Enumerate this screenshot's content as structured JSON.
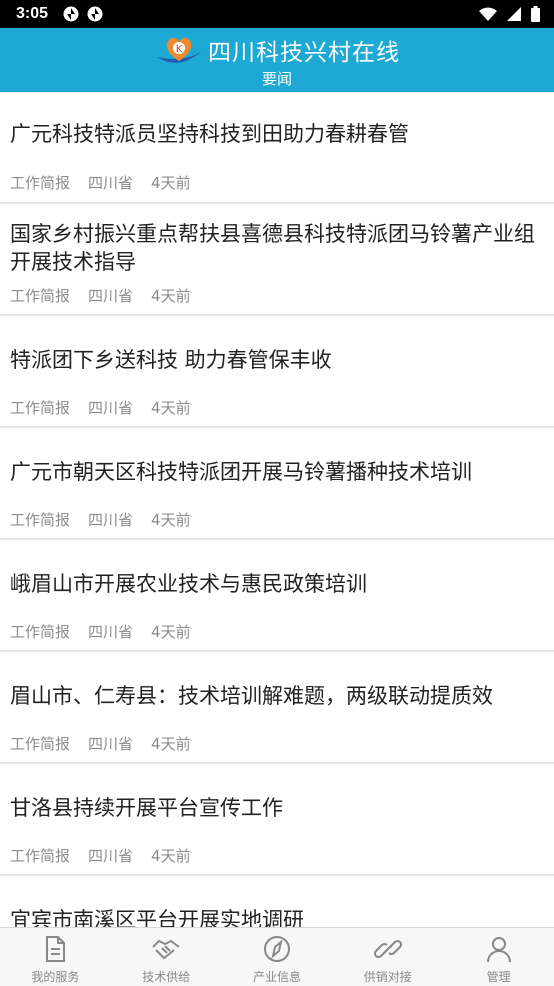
{
  "status_bar": {
    "time": "3:05"
  },
  "header": {
    "title": "四川科技兴村在线",
    "subtitle": "要闻"
  },
  "news": [
    {
      "title": "广元科技特派员坚持科技到田助力春耕春管",
      "category": "工作简报",
      "region": "四川省",
      "time": "4天前"
    },
    {
      "title": "国家乡村振兴重点帮扶县喜德县科技特派团马铃薯产业组开展技术指导",
      "category": "工作简报",
      "region": "四川省",
      "time": "4天前"
    },
    {
      "title": "特派团下乡送科技 助力春管保丰收",
      "category": "工作简报",
      "region": "四川省",
      "time": "4天前"
    },
    {
      "title": "广元市朝天区科技特派团开展马铃薯播种技术培训",
      "category": "工作简报",
      "region": "四川省",
      "time": "4天前"
    },
    {
      "title": "峨眉山市开展农业技术与惠民政策培训",
      "category": "工作简报",
      "region": "四川省",
      "time": "4天前"
    },
    {
      "title": "眉山市、仁寿县：技术培训解难题，两级联动提质效",
      "category": "工作简报",
      "region": "四川省",
      "time": "4天前"
    },
    {
      "title": "甘洛县持续开展平台宣传工作",
      "category": "工作简报",
      "region": "四川省",
      "time": "4天前"
    },
    {
      "title": "宜宾市南溪区平台开展实地调研",
      "category": "",
      "region": "",
      "time": ""
    }
  ],
  "tabs": [
    {
      "label": "我的服务",
      "icon": "document-icon"
    },
    {
      "label": "技术供给",
      "icon": "handshake-icon"
    },
    {
      "label": "产业信息",
      "icon": "compass-icon"
    },
    {
      "label": "供销对接",
      "icon": "link-icon"
    },
    {
      "label": "管理",
      "icon": "user-icon"
    }
  ],
  "colors": {
    "header_bg": "#1ea9d4",
    "tab_inactive": "#888888"
  }
}
